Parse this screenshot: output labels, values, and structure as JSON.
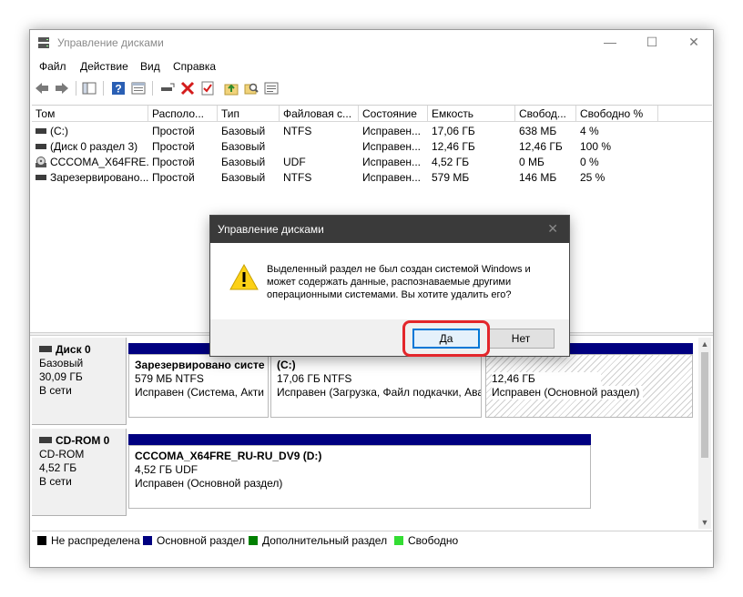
{
  "window": {
    "title": "Управление дисками",
    "min": "—",
    "max": "☐",
    "close": "✕"
  },
  "menu": [
    "Файл",
    "Действие",
    "Вид",
    "Справка"
  ],
  "volume_list": {
    "columns": [
      "Том",
      "Располо...",
      "Тип",
      "Файловая с...",
      "Состояние",
      "Емкость",
      "Свобод...",
      "Свободно %"
    ],
    "rows": [
      [
        "(C:)",
        "Простой",
        "Базовый",
        "NTFS",
        "Исправен...",
        "17,06 ГБ",
        "638 МБ",
        "4 %"
      ],
      [
        "(Диск 0 раздел 3)",
        "Простой",
        "Базовый",
        "",
        "Исправен...",
        "12,46 ГБ",
        "12,46 ГБ",
        "100 %"
      ],
      [
        "CCCOMA_X64FRE...",
        "Простой",
        "Базовый",
        "UDF",
        "Исправен...",
        "4,52 ГБ",
        "0 МБ",
        "0 %"
      ],
      [
        "Зарезервировано...",
        "Простой",
        "Базовый",
        "NTFS",
        "Исправен...",
        "579 МБ",
        "146 МБ",
        "25 %"
      ]
    ]
  },
  "disks": [
    {
      "name": "Диск 0",
      "type": "Базовый",
      "size": "30,09 ГБ",
      "status": "В сети",
      "partitions": [
        {
          "name": "Зарезервировано систе",
          "size": "579 МБ NTFS",
          "status": "Исправен (Система, Акти"
        },
        {
          "name": "(C:)",
          "size": "17,06 ГБ NTFS",
          "status": "Исправен (Загрузка, Файл подкачки, Ава"
        },
        {
          "name": "",
          "size": "12,46 ГБ",
          "status": "Исправен (Основной раздел)"
        }
      ]
    },
    {
      "name": "CD-ROM 0",
      "type": "CD-ROM",
      "size": "4,52 ГБ",
      "status": "В сети",
      "partitions": [
        {
          "name": "CCCOMA_X64FRE_RU-RU_DV9  (D:)",
          "size": "4,52 ГБ UDF",
          "status": "Исправен (Основной раздел)"
        }
      ]
    }
  ],
  "legend": [
    {
      "label": "Не распределена",
      "color": "#000000"
    },
    {
      "label": "Основной раздел",
      "color": "#000080"
    },
    {
      "label": "Дополнительный раздел",
      "color": "#008000"
    },
    {
      "label": "Свободно",
      "color": "#33dd33"
    }
  ],
  "dialog": {
    "title": "Управление дисками",
    "close": "✕",
    "message_lines": [
      "Выделенный раздел не был создан системой Windows и",
      "может содержать данные, распознаваемые другими",
      "операционными системами. Вы хотите удалить его?"
    ],
    "yes_label": "Да",
    "no_label": "Нет"
  },
  "scrollbar": {
    "up": "▲",
    "down": "▼"
  },
  "colors": {
    "primary_partition": "#000080",
    "highlight": "#e3262b",
    "dialog_title": "#3a3a3a"
  }
}
